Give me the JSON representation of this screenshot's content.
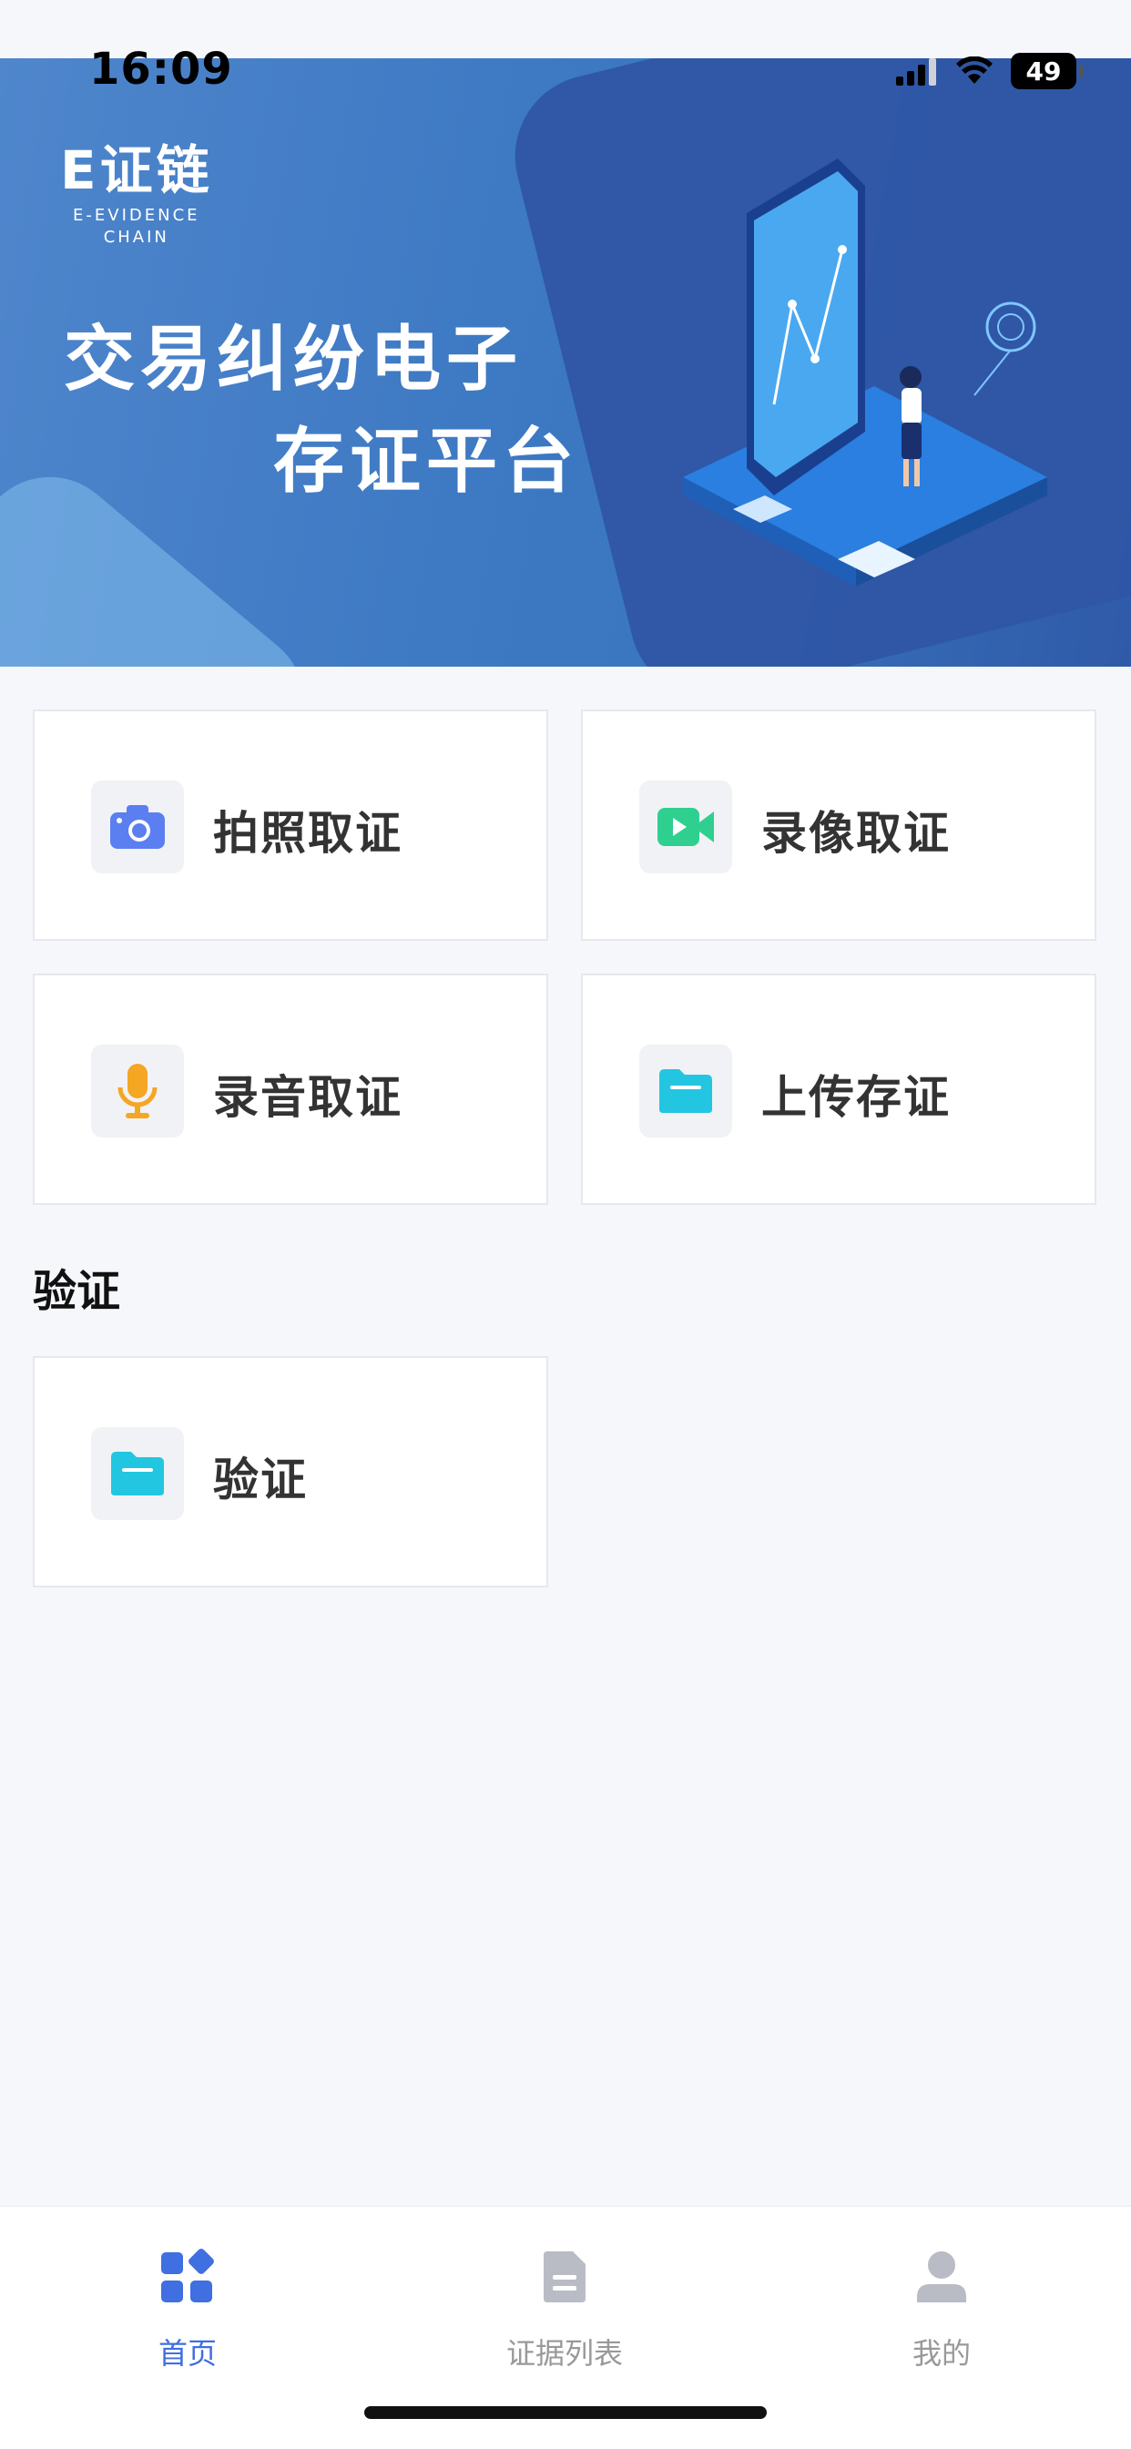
{
  "status_bar": {
    "time": "16:09",
    "battery": "49"
  },
  "banner": {
    "logo_main": "E证链",
    "logo_sub_line1": "E-EVIDENCE",
    "logo_sub_line2": "CHAIN",
    "title_line1": "交易纠纷电子",
    "title_line2": "存证平台"
  },
  "actions": [
    {
      "label": "拍照取证",
      "icon": "camera-icon",
      "color": "#5b7ff0"
    },
    {
      "label": "录像取证",
      "icon": "video-icon",
      "color": "#2fd08f"
    },
    {
      "label": "录音取证",
      "icon": "microphone-icon",
      "color": "#f5a623"
    },
    {
      "label": "上传存证",
      "icon": "folder-icon",
      "color": "#22c6e0"
    }
  ],
  "verify_section": {
    "title": "验证",
    "items": [
      {
        "label": "验证",
        "icon": "folder-icon",
        "color": "#22c6e0"
      }
    ]
  },
  "tabbar": {
    "active_color": "#3f6fe0",
    "inactive_color": "#b9bcc4",
    "tabs": [
      {
        "label": "首页",
        "icon": "home-grid-icon",
        "active": true
      },
      {
        "label": "证据列表",
        "icon": "document-icon",
        "active": false
      },
      {
        "label": "我的",
        "icon": "user-icon",
        "active": false
      }
    ]
  }
}
